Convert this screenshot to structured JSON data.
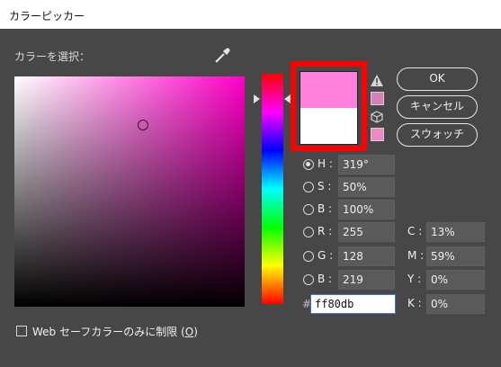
{
  "window": {
    "title": "カラーピッカー"
  },
  "picker": {
    "label": "カラーを選択："
  },
  "preview": {
    "new_color": "#ff80db",
    "current_color": "#ffffff"
  },
  "alerts": {
    "gamut_swatch_color": "#d87fba",
    "web_swatch_color": "#ef88c4"
  },
  "buttons": {
    "ok": "OK",
    "cancel": "キャンセル",
    "swatches": "スウォッチ"
  },
  "hsb": {
    "h": {
      "label": "H :",
      "value": "319°",
      "selected": true
    },
    "s": {
      "label": "S :",
      "value": "50%"
    },
    "b": {
      "label": "B :",
      "value": "100%"
    }
  },
  "rgb": {
    "r": {
      "label": "R :",
      "value": "255"
    },
    "g": {
      "label": "G :",
      "value": "128"
    },
    "b": {
      "label": "B :",
      "value": "219"
    }
  },
  "cmyk": {
    "c": {
      "label": "C :",
      "value": "13%"
    },
    "m": {
      "label": "M :",
      "value": "59%"
    },
    "y": {
      "label": "Y :",
      "value": "0%"
    },
    "k": {
      "label": "K :",
      "value": "0%"
    }
  },
  "hex": {
    "hash": "#",
    "value": "ff80db"
  },
  "web_only": {
    "label_prefix": "Web セーフカラーのみに制限 (",
    "mnemonic": "O",
    "label_suffix": ")",
    "checked": false
  }
}
